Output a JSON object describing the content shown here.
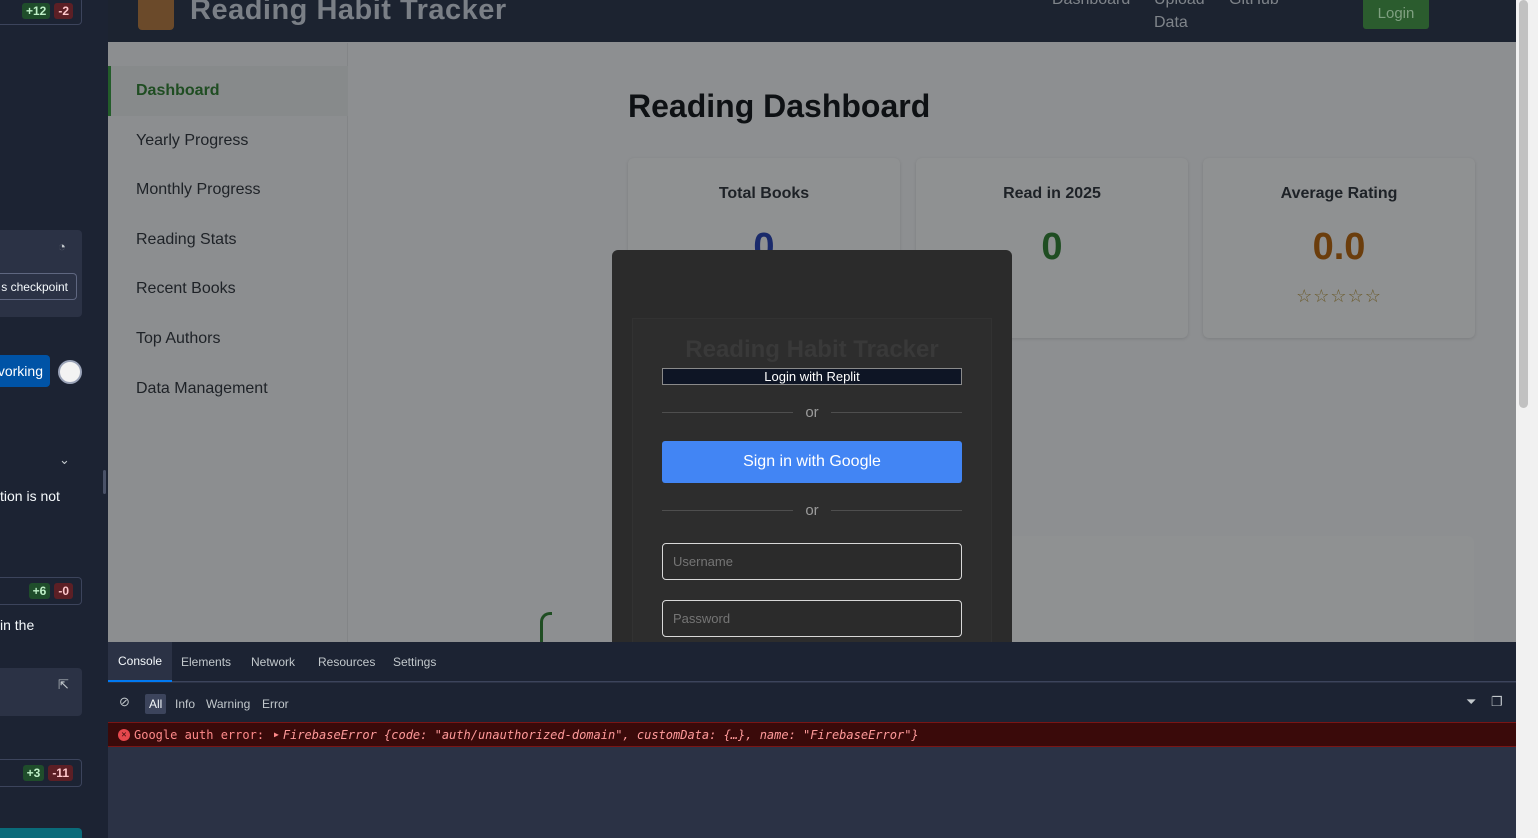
{
  "left_strip": {
    "diff1": {
      "plus": "+12",
      "minus": "-2"
    },
    "checkpoint_button": "s checkpoint",
    "working_button": "vorking",
    "text1": "tion is not",
    "diff2": {
      "plus": "+6",
      "minus": "-0"
    },
    "text2": "in the",
    "diff3": {
      "plus": "+3",
      "minus": "-11"
    }
  },
  "app": {
    "brand": "Reading Habit Tracker",
    "nav": [
      "Dashboard",
      "Upload",
      "Data",
      "GitHub"
    ],
    "login_label": "Login",
    "sidebar": [
      {
        "label": "Dashboard",
        "active": true
      },
      {
        "label": "Yearly Progress"
      },
      {
        "label": "Monthly Progress"
      },
      {
        "label": "Reading Stats"
      },
      {
        "label": "Recent Books"
      },
      {
        "label": "Top Authors"
      },
      {
        "label": "Data Management"
      }
    ],
    "page_title": "Reading Dashboard",
    "stats": [
      {
        "label": "Total Books",
        "value": "0",
        "color": "#1a2a6b"
      },
      {
        "label": "Read in 2025",
        "value": "0",
        "color": "#1f4d22"
      },
      {
        "label": "Average Rating",
        "value": "0.0",
        "color": "#6b3d0c",
        "stars": "☆☆☆☆☆"
      }
    ]
  },
  "modal": {
    "title": "Reading Habit Tracker",
    "replit_login": "Login with Replit",
    "or1": "or",
    "google_signin": "Sign in with Google",
    "or2": "or",
    "username_placeholder": "Username",
    "password_placeholder": "Password"
  },
  "devtools": {
    "tabs": [
      "Console",
      "Elements",
      "Network",
      "Resources",
      "Settings"
    ],
    "filters": [
      "All",
      "Info",
      "Warning",
      "Error"
    ],
    "error": {
      "prefix": "Google auth error:",
      "detail": "FirebaseError {code: \"auth/unauthorized-domain\", customData: {…}, name: \"FirebaseError\"}"
    }
  }
}
